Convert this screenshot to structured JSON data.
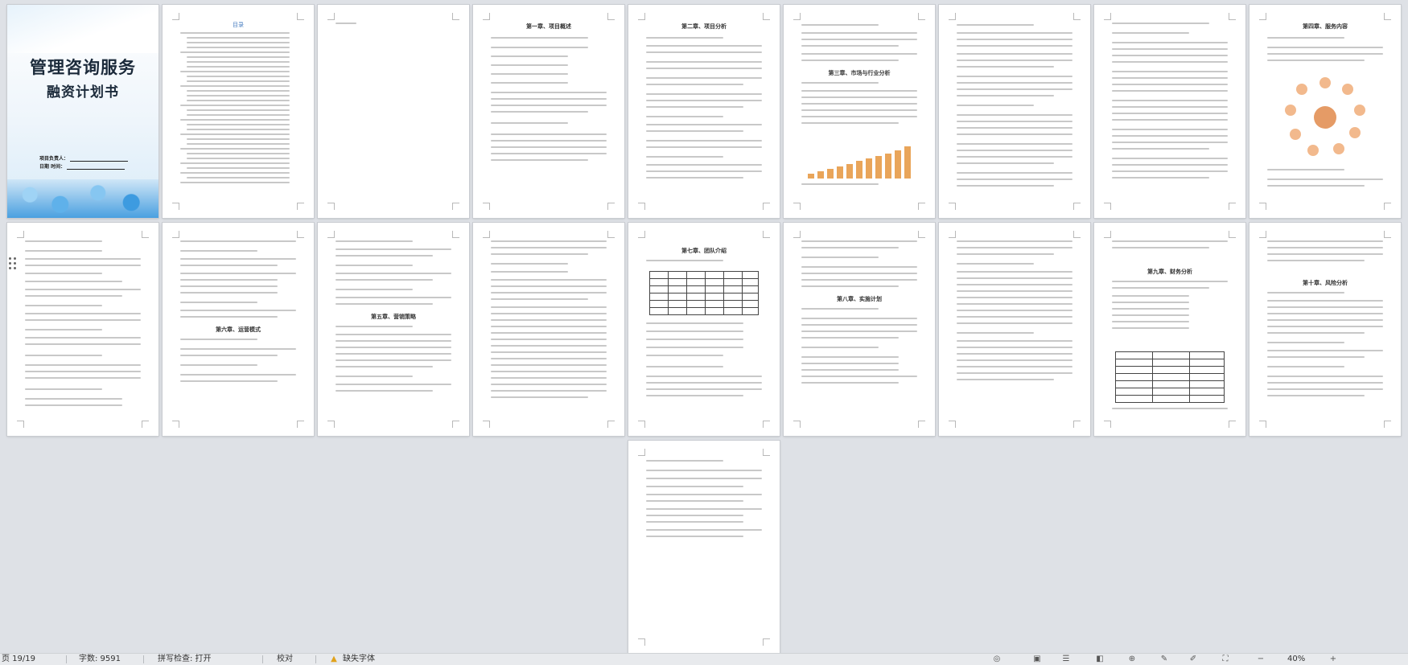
{
  "document": {
    "cover": {
      "title": "管理咨询服务",
      "subtitle": "融资计划书",
      "field_owner": "项目负责人：",
      "field_date": "日期  时间："
    },
    "toc_heading": "目录",
    "page_headings": [
      "第一章、项目概述",
      "第二章、项目分析",
      "第三章、市场与行业分析",
      "第四章、服务内容",
      "第五章、营销策略",
      "第六章、运营模式",
      "第七章、团队介绍",
      "第八章、实施计划",
      "第九章、财务分析",
      "第十章、风险分析"
    ]
  },
  "status_bar": {
    "page_info": "页 19/19",
    "word_count": "字数: 9591",
    "spell_check": "拼写检查: 打开",
    "proofread": "校对",
    "missing_font": "缺失字体",
    "zoom": "40%"
  },
  "colors": {
    "workspace_bg": "#dee1e6",
    "chart_bar": "#e9a55a",
    "cover_blue": "#4aa0e0"
  }
}
